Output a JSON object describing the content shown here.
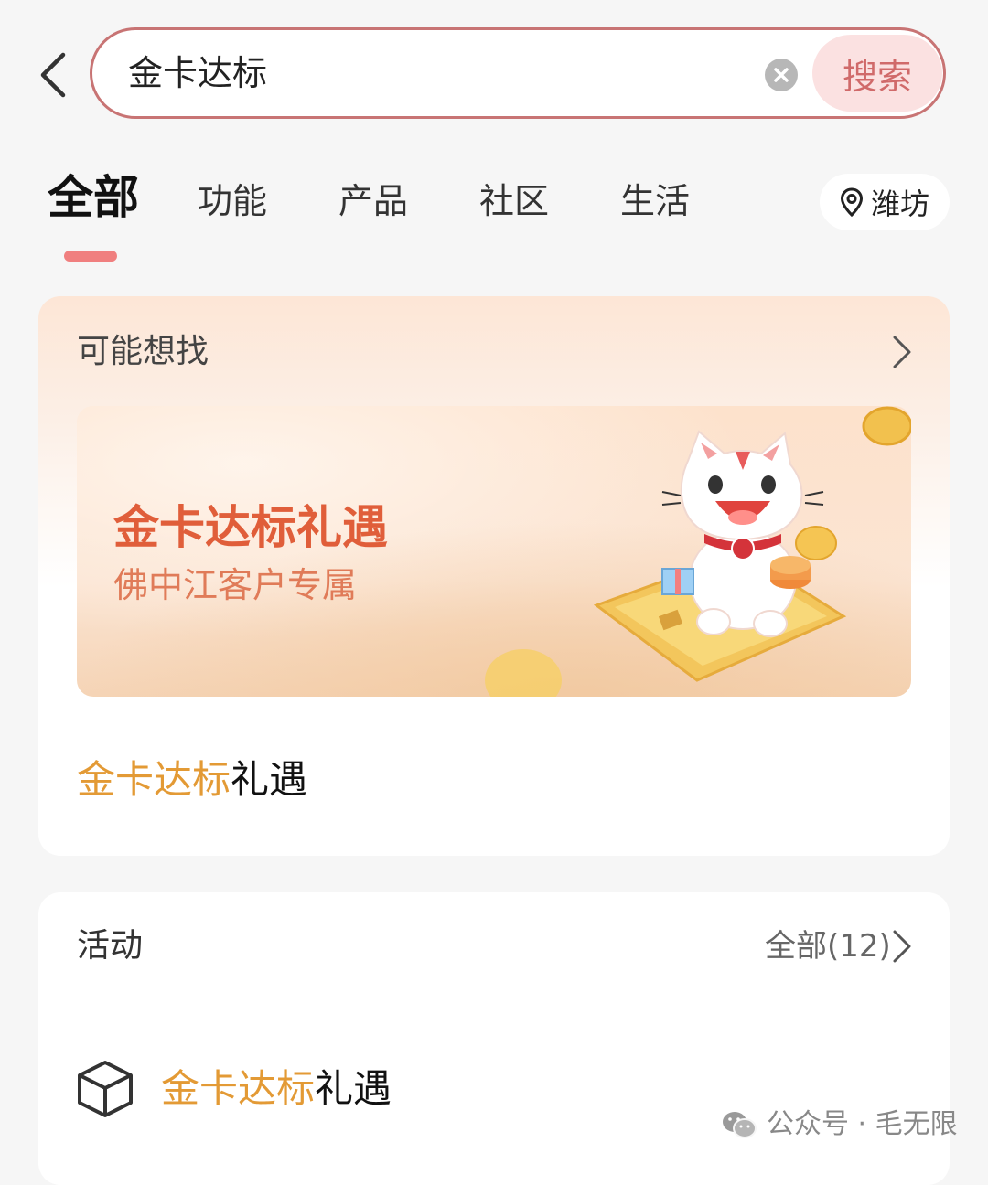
{
  "search": {
    "query": "金卡达标",
    "button_label": "搜索"
  },
  "tabs": [
    {
      "label": "全部",
      "active": true
    },
    {
      "label": "功能"
    },
    {
      "label": "产品"
    },
    {
      "label": "社区"
    },
    {
      "label": "生活"
    }
  ],
  "location": {
    "label": "潍坊"
  },
  "suggest_card": {
    "title": "可能想找",
    "banner": {
      "title": "金卡达标礼遇",
      "subtitle": "佛中江客户专属"
    },
    "result": {
      "highlight": "金卡达标",
      "rest": "礼遇"
    }
  },
  "activity_card": {
    "title": "活动",
    "all_label": "全部(12)",
    "result": {
      "highlight": "金卡达标",
      "rest": "礼遇"
    }
  },
  "watermark": {
    "text": "公众号 · 毛无限"
  },
  "colors": {
    "accent_border": "#c87474",
    "search_button_bg": "#fbe1e1",
    "tab_indicator": "#f07f7f",
    "keyword_highlight": "#e39a35",
    "banner_title": "#e05e3a"
  }
}
